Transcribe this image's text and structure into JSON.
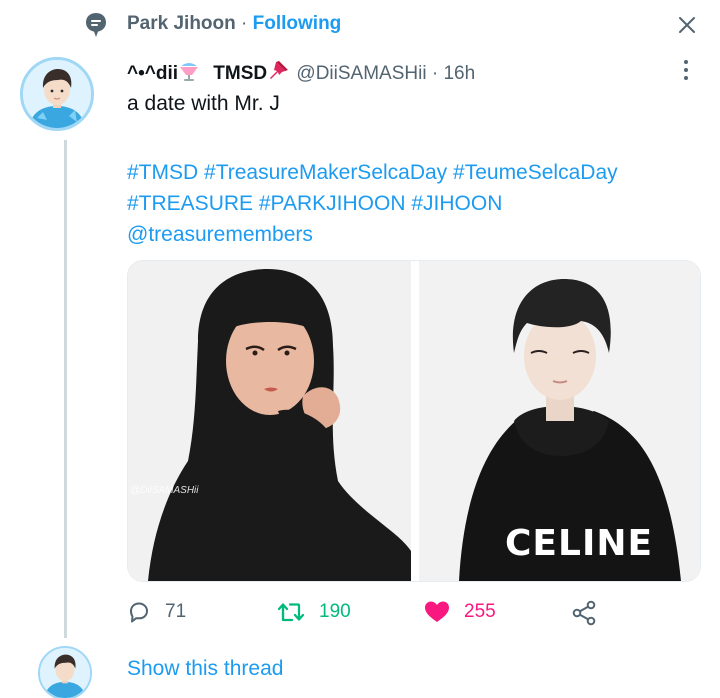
{
  "context": {
    "name": "Park Jihoon",
    "separator": " · ",
    "following": "Following"
  },
  "tweet": {
    "display_name": "^•^dii",
    "display_name_tag": "TMSD",
    "handle": "@DiiSAMASHii",
    "separator": "·",
    "time": "16h",
    "text": "a date with Mr. J",
    "hashtags_line1": [
      "#TMSD",
      "#TreasureMakerSelcaDay",
      "#TeumeSelcaDay"
    ],
    "hashtags_line2": [
      "#TREASURE",
      "#PARKJIHOON",
      "#JIHOON"
    ],
    "mention": "@treasuremembers",
    "media": {
      "watermark": "@DiiSAMASHii",
      "shirt_text": "CELINE"
    }
  },
  "actions": {
    "reply_count": "71",
    "retweet_count": "190",
    "like_count": "255"
  },
  "show_thread": "Show this thread",
  "icons": {
    "context": "topic-bubble-icon",
    "close": "close-icon",
    "more": "more-vertical-icon",
    "reply": "reply-icon",
    "retweet": "retweet-icon",
    "like": "heart-filled-icon",
    "share": "share-icon"
  },
  "colors": {
    "accent": "#1d9bf0",
    "retweet": "#00ba7c",
    "like": "#f91880",
    "muted": "#536471"
  }
}
